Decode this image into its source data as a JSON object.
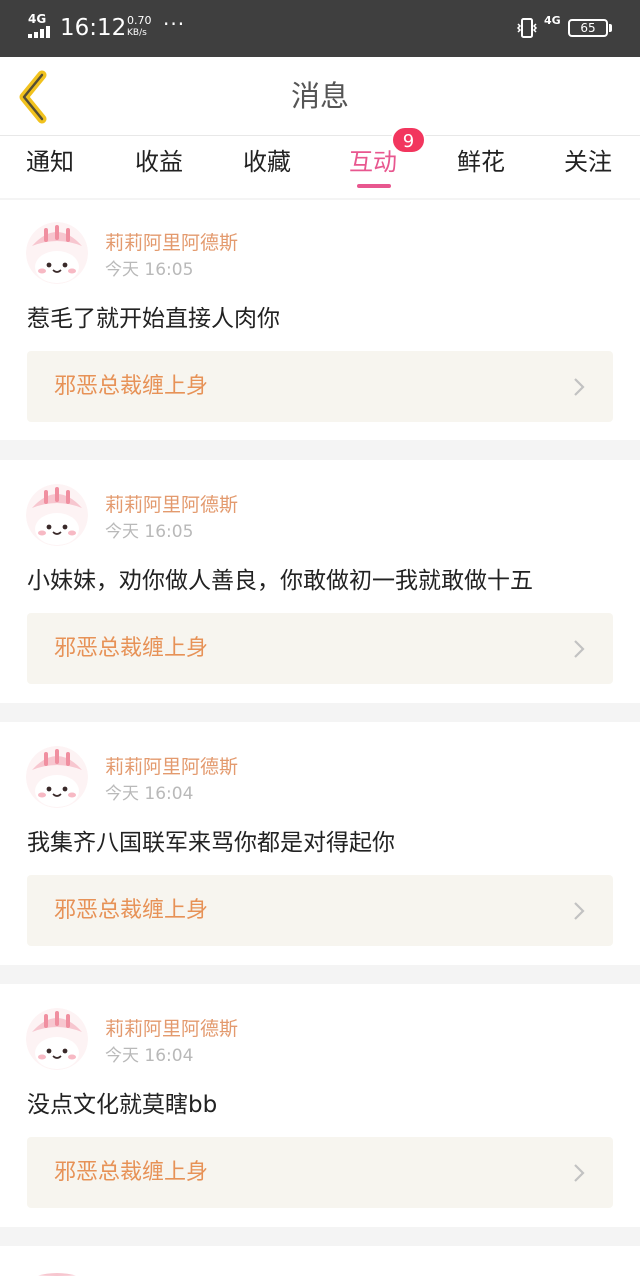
{
  "status_bar": {
    "network": "4G",
    "time": "16:12",
    "speed_value": "0.70",
    "speed_unit": "KB/s",
    "more": "···",
    "network2": "4G",
    "battery": "65"
  },
  "header": {
    "title": "消息",
    "back_icon": "chevron-left-icon"
  },
  "tabs": [
    {
      "label": "通知"
    },
    {
      "label": "收益"
    },
    {
      "label": "收藏"
    },
    {
      "label": "互动",
      "active": true,
      "badge": "9"
    },
    {
      "label": "鲜花"
    },
    {
      "label": "关注"
    }
  ],
  "colors": {
    "accent": "#e8578f",
    "badge": "#f2365e",
    "author": "#e39a6e",
    "reference": "#e79257"
  },
  "messages": [
    {
      "author": "莉莉阿里阿德斯",
      "time": "今天 16:05",
      "comment": "惹毛了就开始直接人肉你",
      "reference": "邪恶总裁缠上身"
    },
    {
      "author": "莉莉阿里阿德斯",
      "time": "今天 16:05",
      "comment": "小妹妹，劝你做人善良，你敢做初一我就敢做十五",
      "reference": "邪恶总裁缠上身"
    },
    {
      "author": "莉莉阿里阿德斯",
      "time": "今天 16:04",
      "comment": "我集齐八国联军来骂你都是对得起你",
      "reference": "邪恶总裁缠上身"
    },
    {
      "author": "莉莉阿里阿德斯",
      "time": "今天 16:04",
      "comment": "没点文化就莫瞎bb",
      "reference": "邪恶总裁缠上身"
    }
  ]
}
